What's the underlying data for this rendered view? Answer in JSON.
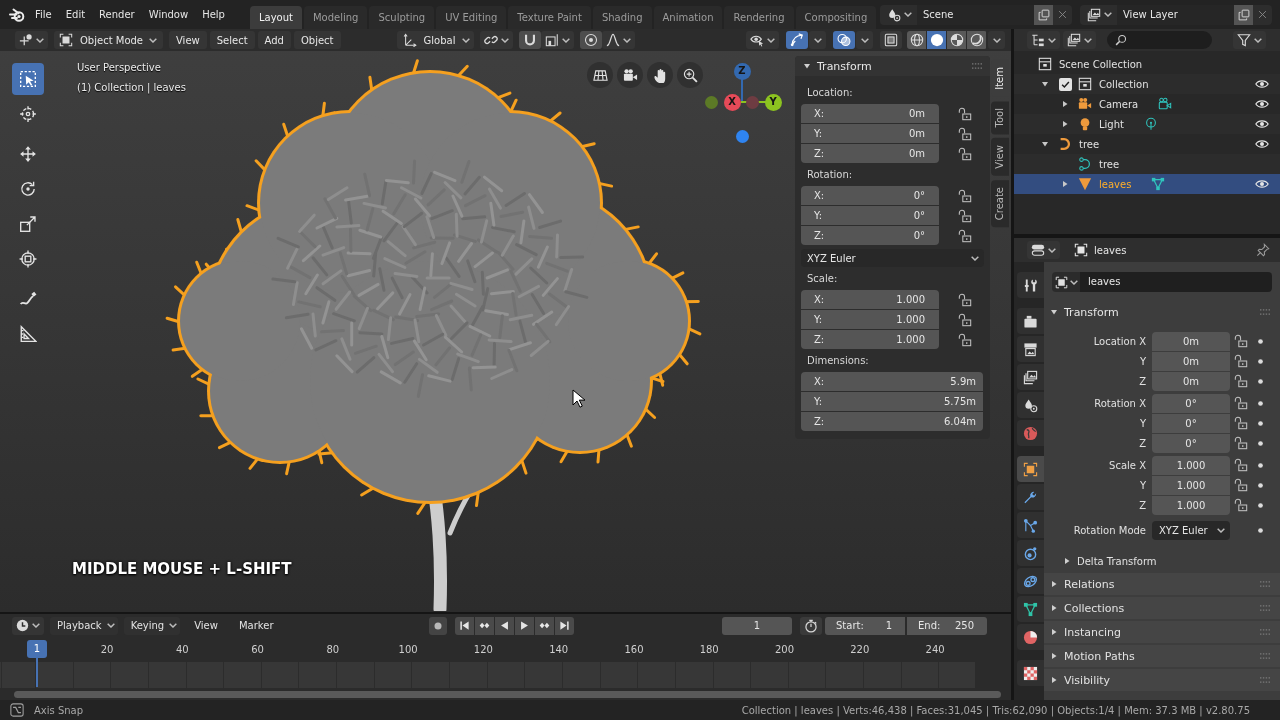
{
  "top_bar": {
    "menus": [
      "File",
      "Edit",
      "Render",
      "Window",
      "Help"
    ],
    "workspaces": [
      {
        "label": "Layout",
        "selected": true
      },
      {
        "label": "Modeling",
        "selected": false
      },
      {
        "label": "Sculpting",
        "selected": false
      },
      {
        "label": "UV Editing",
        "selected": false
      },
      {
        "label": "Texture Paint",
        "selected": false
      },
      {
        "label": "Shading",
        "selected": false
      },
      {
        "label": "Animation",
        "selected": false
      },
      {
        "label": "Rendering",
        "selected": false
      },
      {
        "label": "Compositing",
        "selected": false
      }
    ],
    "scene": "Scene",
    "view_layer": "View Layer"
  },
  "viewport_header": {
    "mode": "Object Mode",
    "menus": [
      "View",
      "Select",
      "Add",
      "Object"
    ],
    "orientation": "Global",
    "snap_on": false,
    "proportional_on": false,
    "gizmos_on": true,
    "overlays_on": true,
    "xray_on": false,
    "shading": [
      {
        "kind": "wireframe",
        "selected": false
      },
      {
        "kind": "solid",
        "selected": true
      },
      {
        "kind": "material",
        "selected": false
      },
      {
        "kind": "rendered",
        "selected": false
      }
    ]
  },
  "toolbar": [
    {
      "kind": "select_box",
      "selected": true
    },
    {
      "kind": "cursor",
      "selected": false
    },
    {
      "kind": "move",
      "selected": false
    },
    {
      "kind": "rotate",
      "selected": false
    },
    {
      "kind": "scale",
      "selected": false
    },
    {
      "kind": "transform",
      "selected": false
    },
    {
      "kind": "annotate",
      "selected": false
    },
    {
      "kind": "measure",
      "selected": false
    }
  ],
  "viewport": {
    "view_name": "User Perspective",
    "context": "(1) Collection | leaves",
    "caption": "MIDDLE MOUSE + L-SHIFT",
    "nav_gizmo": [
      {
        "kind": "positive",
        "label": "Z",
        "color": "#3369b0"
      },
      {
        "kind": "negative",
        "color": "#5c7a26"
      },
      {
        "kind": "negative",
        "color": "#6e3c42"
      },
      {
        "kind": "positive",
        "label": "X",
        "color": "#e64a58"
      },
      {
        "kind": "positive",
        "label": "Y",
        "color": "#8cc320"
      },
      {
        "kind": "negative",
        "color": "#2f84f0"
      }
    ]
  },
  "sidebar": {
    "tabs": [
      {
        "label": "Item",
        "selected": true
      },
      {
        "label": "Tool",
        "selected": false
      },
      {
        "label": "View",
        "selected": false
      },
      {
        "label": "Create",
        "selected": false
      }
    ],
    "panel": {
      "title": "Transform",
      "expanded": true,
      "groups": [
        {
          "kind": "vector",
          "label": "Location:",
          "fields": [
            {
              "axis": "X:",
              "value": "0m",
              "locked": false
            },
            {
              "axis": "Y:",
              "value": "0m",
              "locked": false
            },
            {
              "axis": "Z:",
              "value": "0m",
              "locked": false
            }
          ]
        },
        {
          "kind": "vector",
          "label": "Rotation:",
          "fields": [
            {
              "axis": "X:",
              "value": "0°",
              "locked": false
            },
            {
              "axis": "Y:",
              "value": "0°",
              "locked": false
            },
            {
              "axis": "Z:",
              "value": "0°",
              "locked": false
            }
          ]
        },
        {
          "kind": "dropdown",
          "value": "XYZ Euler"
        },
        {
          "kind": "vector",
          "label": "Scale:",
          "fields": [
            {
              "axis": "X:",
              "value": "1.000",
              "locked": false
            },
            {
              "axis": "Y:",
              "value": "1.000",
              "locked": false
            },
            {
              "axis": "Z:",
              "value": "1.000",
              "locked": false
            }
          ]
        },
        {
          "kind": "vector",
          "label": "Dimensions:",
          "fields": [
            {
              "axis": "X:",
              "value": "5.9m"
            },
            {
              "axis": "Y:",
              "value": "5.75m"
            },
            {
              "axis": "Z:",
              "value": "6.04m"
            }
          ]
        }
      ]
    }
  },
  "outliner": {
    "tree": [
      {
        "name": "Scene Collection",
        "kind": "scene_collection",
        "selected": false,
        "children": [
          {
            "name": "Collection",
            "kind": "collection",
            "expanded": true,
            "checked": true,
            "visible": true,
            "selected": false,
            "children": [
              {
                "name": "Camera",
                "kind": "camera",
                "expanded": false,
                "visible": true,
                "selected": false
              },
              {
                "name": "Light",
                "kind": "light",
                "expanded": false,
                "visible": true,
                "selected": false
              }
            ]
          },
          {
            "name": "tree",
            "kind": "curve",
            "expanded": true,
            "visible": true,
            "selected": false,
            "children": [
              {
                "name": "tree",
                "kind": "curve_data",
                "selected": false
              },
              {
                "name": "leaves",
                "kind": "mesh",
                "expanded": false,
                "visible": true,
                "selected": true
              }
            ]
          }
        ]
      }
    ]
  },
  "properties": {
    "object": "leaves",
    "tabs": [
      {
        "kind": "tool",
        "selected": false
      },
      {
        "kind": "render",
        "selected": false
      },
      {
        "kind": "output",
        "selected": false
      },
      {
        "kind": "view_layer",
        "selected": false
      },
      {
        "kind": "scene",
        "selected": false
      },
      {
        "kind": "world",
        "selected": false
      },
      {
        "kind": "object",
        "selected": true
      },
      {
        "kind": "modifiers",
        "selected": false
      },
      {
        "kind": "particles",
        "selected": false
      },
      {
        "kind": "physics",
        "selected": false
      },
      {
        "kind": "constraints",
        "selected": false
      },
      {
        "kind": "data",
        "selected": false
      },
      {
        "kind": "material",
        "selected": false
      },
      {
        "kind": "texture",
        "selected": false
      }
    ],
    "name_field": "leaves",
    "transform": {
      "title": "Transform",
      "expanded": true,
      "groups": [
        [
          {
            "label": "Location X",
            "value": "0m",
            "locked": false
          },
          {
            "label": "Y",
            "value": "0m",
            "locked": false
          },
          {
            "label": "Z",
            "value": "0m",
            "locked": false
          }
        ],
        [
          {
            "label": "Rotation X",
            "value": "0°",
            "locked": false
          },
          {
            "label": "Y",
            "value": "0°",
            "locked": false
          },
          {
            "label": "Z",
            "value": "0°",
            "locked": false
          }
        ],
        [
          {
            "label": "Scale X",
            "value": "1.000",
            "locked": false
          },
          {
            "label": "Y",
            "value": "1.000",
            "locked": false
          },
          {
            "label": "Z",
            "value": "1.000",
            "locked": false
          }
        ]
      ],
      "rotation_mode": {
        "label": "Rotation Mode",
        "value": "XYZ Euler"
      },
      "subpanels": [
        {
          "title": "Delta Transform",
          "expanded": false
        }
      ]
    },
    "panels": [
      {
        "title": "Relations",
        "expanded": false
      },
      {
        "title": "Collections",
        "expanded": false
      },
      {
        "title": "Instancing",
        "expanded": false
      },
      {
        "title": "Motion Paths",
        "expanded": false
      },
      {
        "title": "Visibility",
        "expanded": false
      }
    ]
  },
  "timeline": {
    "menus": [
      {
        "kind": "dropdown",
        "label": "Playback"
      },
      {
        "kind": "dropdown",
        "label": "Keying"
      },
      {
        "kind": "menu",
        "label": "View"
      },
      {
        "kind": "menu",
        "label": "Marker"
      }
    ],
    "auto_keying_on": false,
    "current_frame": "1",
    "preview_range_on": false,
    "start": {
      "label": "Start:",
      "value": "1"
    },
    "end": {
      "label": "End:",
      "value": "250"
    },
    "ruler": {
      "playhead": "1",
      "ticks": [
        "20",
        "40",
        "60",
        "80",
        "100",
        "120",
        "140",
        "160",
        "180",
        "200",
        "220",
        "240"
      ]
    }
  },
  "status_bar": {
    "hint": "Axis Snap",
    "stats": "Collection | leaves | Verts:46,438 | Faces:31,045 | Tris:62,090 | Objects:1/4 | Mem: 37.3 MB | v2.80.75"
  }
}
